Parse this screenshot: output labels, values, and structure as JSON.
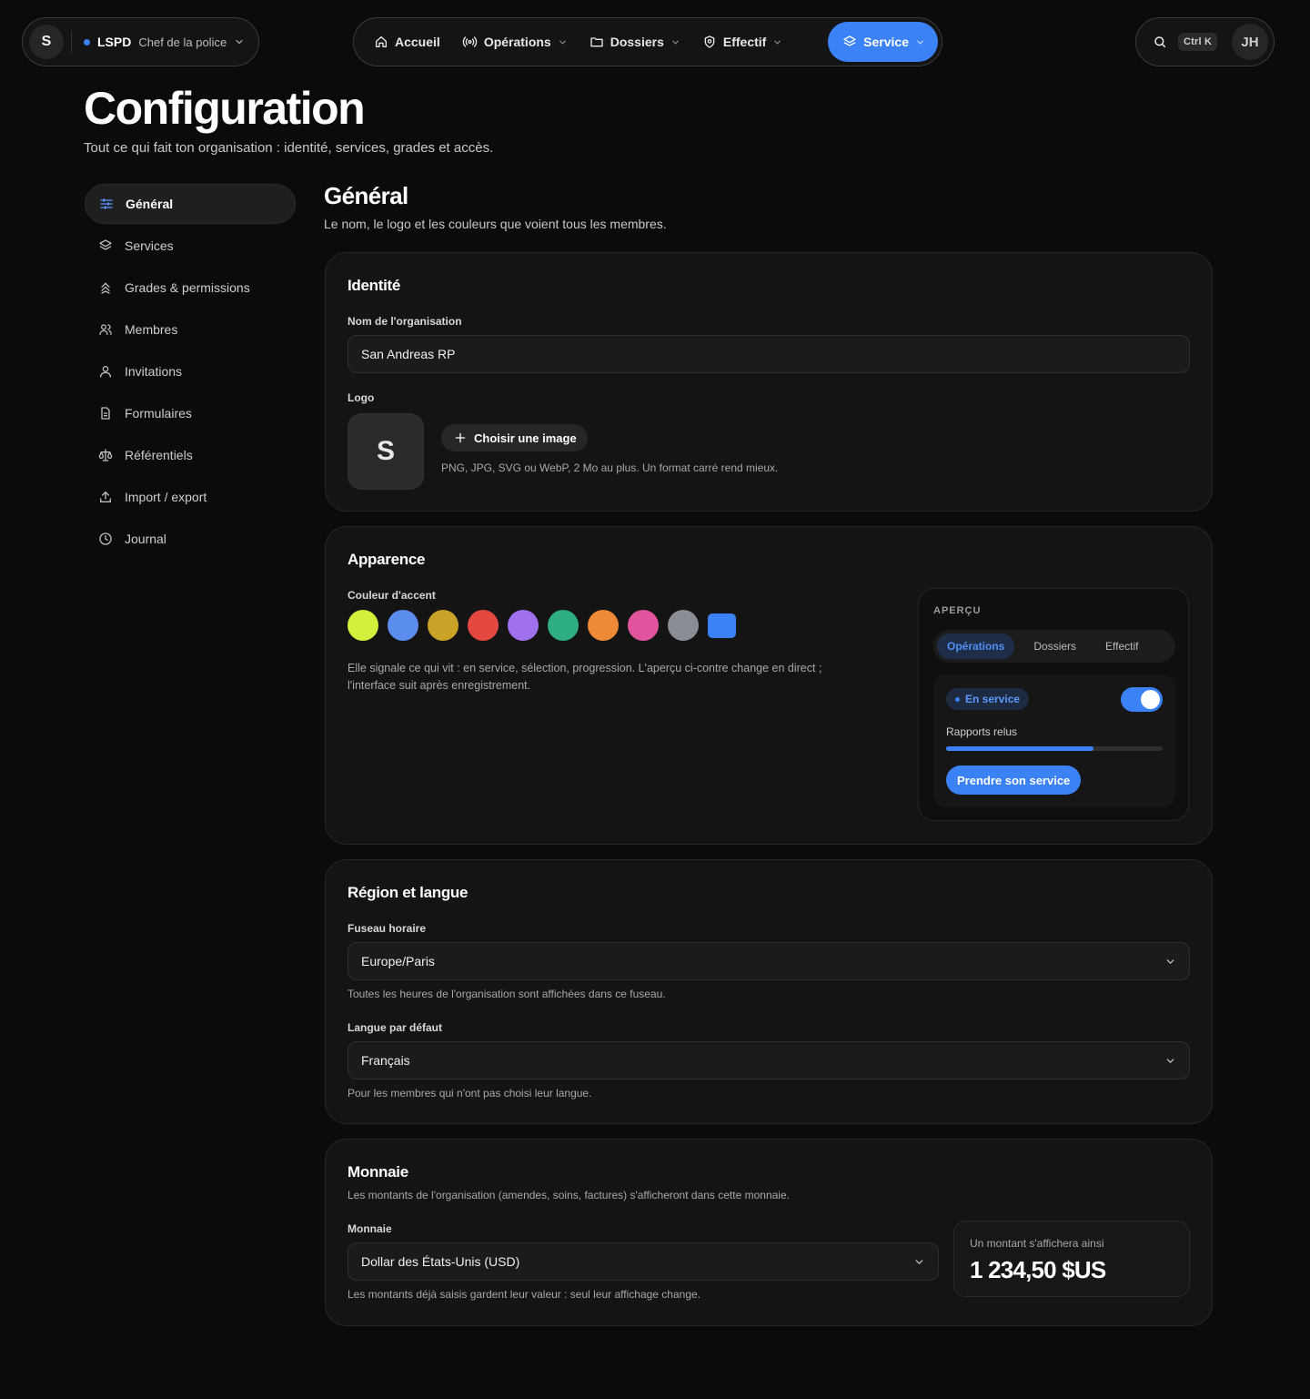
{
  "topbar": {
    "org": {
      "avatar": "S",
      "name": "LSPD",
      "role": "Chef de la police",
      "icon": "chevron-down-icon"
    },
    "nav": [
      {
        "label": "Accueil",
        "icon": "home-icon"
      },
      {
        "label": "Opérations",
        "icon": "radio-icon"
      },
      {
        "label": "Dossiers",
        "icon": "folder-icon"
      },
      {
        "label": "Effectif",
        "icon": "badge-icon"
      },
      {
        "label": "Service",
        "icon": "layers-icon",
        "active": true
      }
    ],
    "search": {
      "icon": "search-icon",
      "shortcut": "Ctrl K"
    },
    "user": {
      "initials": "JH"
    }
  },
  "page": {
    "title": "Configuration",
    "subtitle": "Tout ce qui fait ton organisation : identité, services, grades et accès."
  },
  "sidebar": {
    "items": [
      {
        "label": "Général",
        "icon": "sliders-icon",
        "active": true
      },
      {
        "label": "Services",
        "icon": "layers-icon"
      },
      {
        "label": "Grades & permissions",
        "icon": "chevrons-up-icon"
      },
      {
        "label": "Membres",
        "icon": "users-icon"
      },
      {
        "label": "Invitations",
        "icon": "user-icon"
      },
      {
        "label": "Formulaires",
        "icon": "file-icon"
      },
      {
        "label": "Référentiels",
        "icon": "scale-icon"
      },
      {
        "label": "Import / export",
        "icon": "upload-icon"
      },
      {
        "label": "Journal",
        "icon": "clock-icon"
      }
    ]
  },
  "section": {
    "title": "Général",
    "subtitle": "Le nom, le logo et les couleurs que voient tous les membres."
  },
  "identity": {
    "title": "Identité",
    "org_name_label": "Nom de l'organisation",
    "org_name_value": "San Andreas RP",
    "logo_label": "Logo",
    "logo_letter": "S",
    "choose_button": "Choisir une image",
    "logo_hint": "PNG, JPG, SVG ou WebP, 2 Mo au plus. Un format carré rend mieux."
  },
  "appearance": {
    "title": "Apparence",
    "accent_label": "Couleur d'accent",
    "colors": [
      "#d4f03c",
      "#5b8def",
      "#c9a227",
      "#e5483f",
      "#a070ee",
      "#2fae82",
      "#ee8a36",
      "#e0559e",
      "#8a8d94",
      "#3b82f6"
    ],
    "selected_color": "#3b82f6",
    "description": "Elle signale ce qui vit : en service, sélection, progression. L'aperçu ci-contre change en direct ; l'interface suit après enregistrement.",
    "preview": {
      "label": "APERÇU",
      "tabs": [
        "Opérations",
        "Dossiers",
        "Effectif"
      ],
      "status": "En service",
      "toggle_on": true,
      "progress_label": "Rapports relus",
      "progress": 0.68,
      "button": "Prendre son service"
    }
  },
  "region": {
    "title": "Région et langue",
    "timezone_label": "Fuseau horaire",
    "timezone_value": "Europe/Paris",
    "timezone_hint": "Toutes les heures de l'organisation sont affichées dans ce fuseau.",
    "language_label": "Langue par défaut",
    "language_value": "Français",
    "language_hint": "Pour les membres qui n'ont pas choisi leur langue."
  },
  "currency": {
    "title": "Monnaie",
    "description": "Les montants de l'organisation (amendes, soins, factures) s'afficheront dans cette monnaie.",
    "label": "Monnaie",
    "value": "Dollar des États-Unis (USD)",
    "hint": "Les montants déjà saisis gardent leur valeur : seul leur affichage change.",
    "preview_label": "Un montant s'affichera ainsi",
    "preview_value": "1 234,50 $US"
  }
}
